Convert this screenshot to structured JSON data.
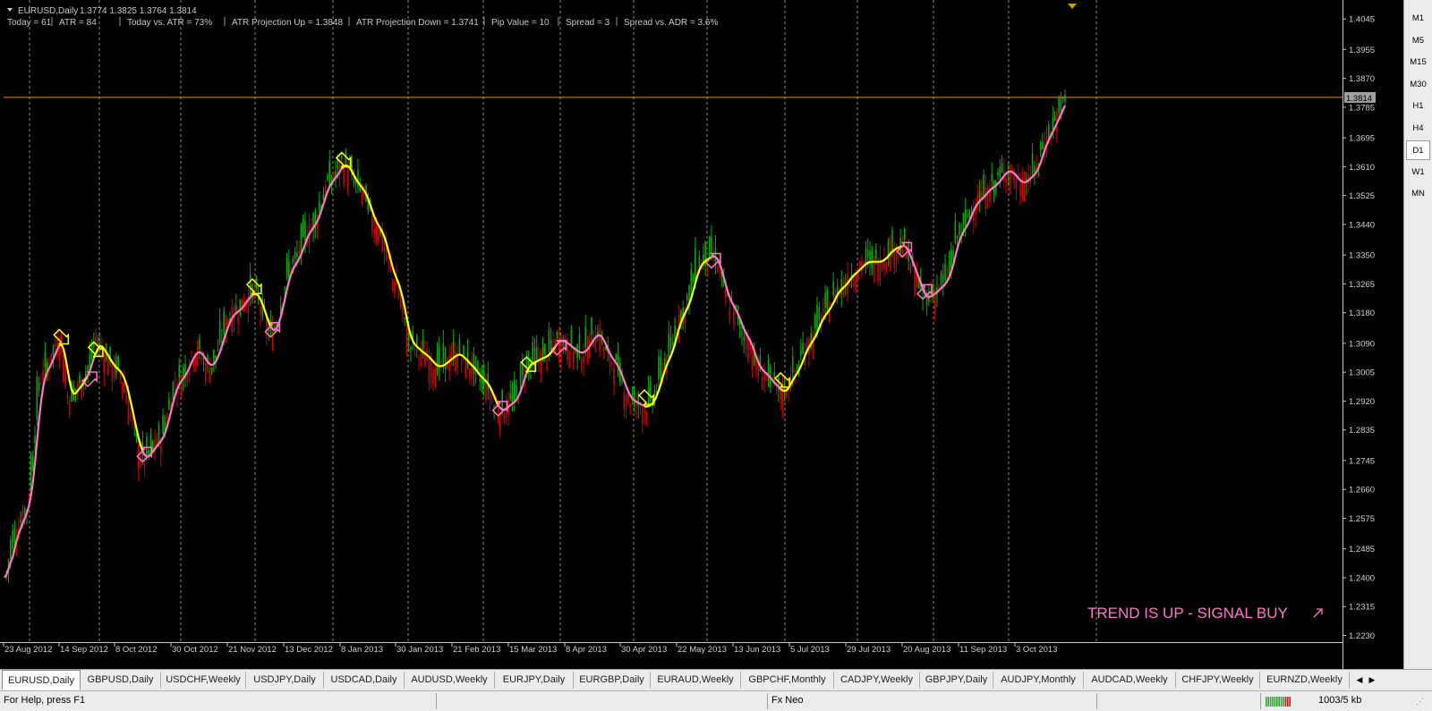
{
  "window": {
    "symbol_title": "EURUSD,Daily",
    "ohlc": "1.3774 1.3825 1.3764 1.3814"
  },
  "info_bar": [
    "Today = 61",
    "ATR = 84",
    "Today vs. ATR = 73%",
    "ATR Projection Up = 1.3848",
    "ATR Projection Down = 1.3741",
    "Pip Value = 10",
    "Spread = 3",
    "Spread vs. ADR = 3.6%"
  ],
  "price_axis": {
    "labels": [
      "1.4045",
      "1.3955",
      "1.3870",
      "1.3785",
      "1.3695",
      "1.3610",
      "1.3525",
      "1.3440",
      "1.3350",
      "1.3265",
      "1.3180",
      "1.3090",
      "1.3005",
      "1.2920",
      "1.2835",
      "1.2745",
      "1.2660",
      "1.2575",
      "1.2485",
      "1.2400",
      "1.2315",
      "1.2230"
    ],
    "current_price": "1.3814",
    "min": 1.2205,
    "max": 1.4085
  },
  "date_axis": [
    "23 Aug 2012",
    "14 Sep 2012",
    "8 Oct 2012",
    "30 Oct 2012",
    "21 Nov 2012",
    "13 Dec 2012",
    "8 Jan 2013",
    "30 Jan 2013",
    "21 Feb 2013",
    "15 Mar 2013",
    "8 Apr 2013",
    "30 Apr 2013",
    "22 May 2013",
    "13 Jun 2013",
    "5 Jul 2013",
    "29 Jul 2013",
    "20 Aug 2013",
    "11 Sep 2013",
    "3 Oct 2013"
  ],
  "signal": {
    "text": "TREND IS UP - SIGNAL BUY",
    "icon": "arrow-up-right-icon",
    "color": "#ff77c8"
  },
  "timeframes": [
    "M1",
    "M5",
    "M15",
    "M30",
    "H1",
    "H4",
    "D1",
    "W1",
    "MN"
  ],
  "active_timeframe": "D1",
  "tabs": [
    "EURUSD,Daily",
    "GBPUSD,Daily",
    "USDCHF,Weekly",
    "USDJPY,Daily",
    "USDCAD,Daily",
    "AUDUSD,Weekly",
    "EURJPY,Daily",
    "EURGBP,Daily",
    "EURAUD,Weekly",
    "GBPCHF,Monthly",
    "CADJPY,Weekly",
    "GBPJPY,Daily",
    "AUDJPY,Monthly",
    "AUDCAD,Weekly",
    "CHFJPY,Weekly",
    "EURNZD,Weekly"
  ],
  "active_tab": "EURUSD,Daily",
  "status": {
    "help": "For Help, press F1",
    "profile": "Fx Neo",
    "traffic": "1003/5 kb"
  },
  "colors": {
    "up_candle": "#00b000",
    "down_candle": "#d00000",
    "up_trend": "#ff77c8",
    "down_trend": "#ffff00",
    "price_line": "#c8a000",
    "background": "#000000"
  },
  "chart_data": {
    "type": "candlestick",
    "title": "EURUSD,Daily",
    "x": [
      "23 Aug 2012",
      "14 Sep 2012",
      "8 Oct 2012",
      "30 Oct 2012",
      "21 Nov 2012",
      "13 Dec 2012",
      "8 Jan 2013",
      "30 Jan 2013",
      "21 Feb 2013",
      "15 Mar 2013",
      "8 Apr 2013",
      "30 Apr 2013",
      "22 May 2013",
      "13 Jun 2013",
      "5 Jul 2013",
      "29 Jul 2013",
      "20 Aug 2013",
      "11 Sep 2013",
      "3 Oct 2013"
    ],
    "ylim": [
      1.2205,
      1.4085
    ],
    "approx_close_path": [
      [
        0,
        1.24
      ],
      [
        4,
        1.252
      ],
      [
        10,
        1.26
      ],
      [
        18,
        1.3
      ],
      [
        27,
        1.31
      ],
      [
        31,
        1.293
      ],
      [
        37,
        1.297
      ],
      [
        41,
        1.302
      ],
      [
        44,
        1.309
      ],
      [
        55,
        1.301
      ],
      [
        68,
        1.275
      ],
      [
        75,
        1.28
      ],
      [
        85,
        1.298
      ],
      [
        94,
        1.307
      ],
      [
        100,
        1.302
      ],
      [
        112,
        1.318
      ],
      [
        122,
        1.324
      ],
      [
        131,
        1.312
      ],
      [
        141,
        1.332
      ],
      [
        150,
        1.343
      ],
      [
        160,
        1.357
      ],
      [
        166,
        1.362
      ],
      [
        174,
        1.355
      ],
      [
        183,
        1.343
      ],
      [
        192,
        1.327
      ],
      [
        199,
        1.309
      ],
      [
        205,
        1.306
      ],
      [
        212,
        1.302
      ],
      [
        223,
        1.306
      ],
      [
        227,
        1.303
      ],
      [
        235,
        1.298
      ],
      [
        243,
        1.289
      ],
      [
        250,
        1.292
      ],
      [
        257,
        1.303
      ],
      [
        265,
        1.305
      ],
      [
        272,
        1.31
      ],
      [
        283,
        1.306
      ],
      [
        291,
        1.312
      ],
      [
        298,
        1.304
      ],
      [
        308,
        1.292
      ],
      [
        315,
        1.29
      ],
      [
        318,
        1.292
      ],
      [
        325,
        1.304
      ],
      [
        333,
        1.318
      ],
      [
        342,
        1.333
      ],
      [
        348,
        1.335
      ],
      [
        357,
        1.32
      ],
      [
        364,
        1.311
      ],
      [
        371,
        1.301
      ],
      [
        380,
        1.296
      ],
      [
        382,
        1.294
      ],
      [
        388,
        1.3
      ],
      [
        395,
        1.309
      ],
      [
        403,
        1.318
      ],
      [
        410,
        1.325
      ],
      [
        418,
        1.33
      ],
      [
        423,
        1.333
      ],
      [
        430,
        1.333
      ],
      [
        437,
        1.337
      ],
      [
        442,
        1.338
      ],
      [
        447,
        1.33
      ],
      [
        452,
        1.322
      ],
      [
        457,
        1.324
      ],
      [
        462,
        1.327
      ],
      [
        470,
        1.342
      ],
      [
        478,
        1.351
      ],
      [
        485,
        1.355
      ],
      [
        493,
        1.36
      ],
      [
        500,
        1.356
      ],
      [
        506,
        1.359
      ],
      [
        512,
        1.369
      ],
      [
        518,
        1.376
      ],
      [
        522,
        1.382
      ]
    ],
    "trend_segments": [
      {
        "trend": "up",
        "from": 1.24,
        "to": 1.301,
        "label": "up"
      },
      {
        "trend": "down",
        "from": 1.31,
        "to": 1.293,
        "label": "down"
      },
      {
        "trend": "up",
        "from": 1.293,
        "to": 1.3,
        "label": "up"
      },
      {
        "trend": "down",
        "from": 1.309,
        "to": 1.275,
        "label": "down"
      },
      {
        "trend": "up",
        "from": 1.275,
        "to": 1.324,
        "label": "up"
      },
      {
        "trend": "down",
        "from": 1.324,
        "to": 1.318,
        "label": "down"
      },
      {
        "trend": "up",
        "from": 1.312,
        "to": 1.357,
        "label": "up"
      },
      {
        "trend": "down",
        "from": 1.362,
        "to": 1.289,
        "label": "down"
      },
      {
        "trend": "up",
        "from": 1.289,
        "to": 1.306,
        "label": "up"
      },
      {
        "trend": "down",
        "from": 1.312,
        "to": 1.29,
        "label": "down"
      },
      {
        "trend": "up",
        "from": 1.29,
        "to": 1.333,
        "label": "up"
      },
      {
        "trend": "down",
        "from": 1.335,
        "to": 1.301,
        "label": "down"
      },
      {
        "trend": "up",
        "from": 1.294,
        "to": 1.333,
        "label": "up"
      },
      {
        "trend": "down",
        "from": 1.338,
        "to": 1.322,
        "label": "down"
      },
      {
        "trend": "up",
        "from": 1.322,
        "to": 1.382,
        "label": "up"
      }
    ]
  }
}
